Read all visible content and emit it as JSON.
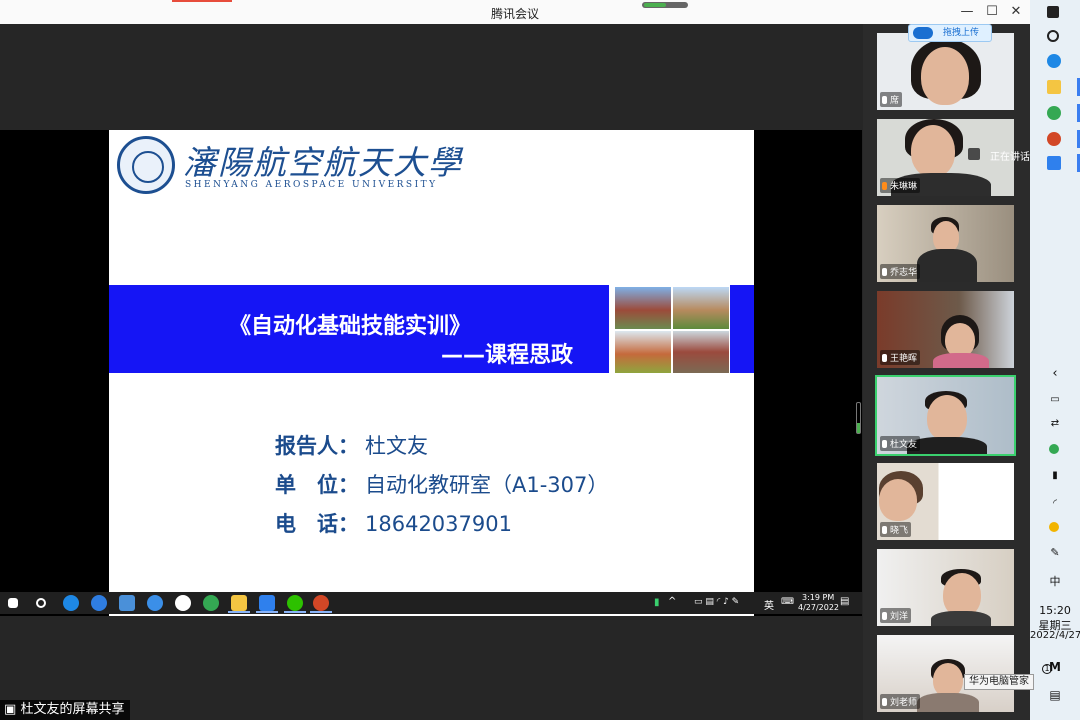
{
  "app": {
    "title": "腾讯会议"
  },
  "window_controls": {
    "minimize": "—",
    "maximize": "☐",
    "close": "✕"
  },
  "slide": {
    "university_cn": "瀋陽航空航天大學",
    "university_en": "SHENYANG AEROSPACE UNIVERSITY",
    "course_title": "《自动化基础技能实训》",
    "course_subtitle": "——课程思政",
    "reporter_label": "报告人：",
    "reporter_value": "杜文友",
    "unit_label": "单　位：",
    "unit_value": "自动化教研室（A1-307）",
    "phone_label": "电　话：",
    "phone_value": "18642037901",
    "banner_color": "#1515f5",
    "text_color": "#1b4b8c"
  },
  "shared_taskbar": {
    "time": "3:19 PM",
    "date": "4/27/2022",
    "lang": "英"
  },
  "share_label": "杜文友的屏幕共享",
  "upload_button": "拖拽上传",
  "speaking_tag": "正在讲话",
  "participants": [
    {
      "name": "席"
    },
    {
      "name": "朱琳琳"
    },
    {
      "name": "乔志华"
    },
    {
      "name": "王艳晖"
    },
    {
      "name": "杜文友"
    },
    {
      "name": "晓飞"
    },
    {
      "name": "刘洋"
    },
    {
      "name": "刘老师"
    }
  ],
  "sidebar": {
    "ime": "中",
    "time": "15:20",
    "weekday": "星期三",
    "date": "2022/4/27",
    "notification_badge": "1",
    "tooltip": "华为电脑管家"
  },
  "colors": {
    "accent": "#3ad06e",
    "sidebar_bg": "#e8f0f6"
  }
}
